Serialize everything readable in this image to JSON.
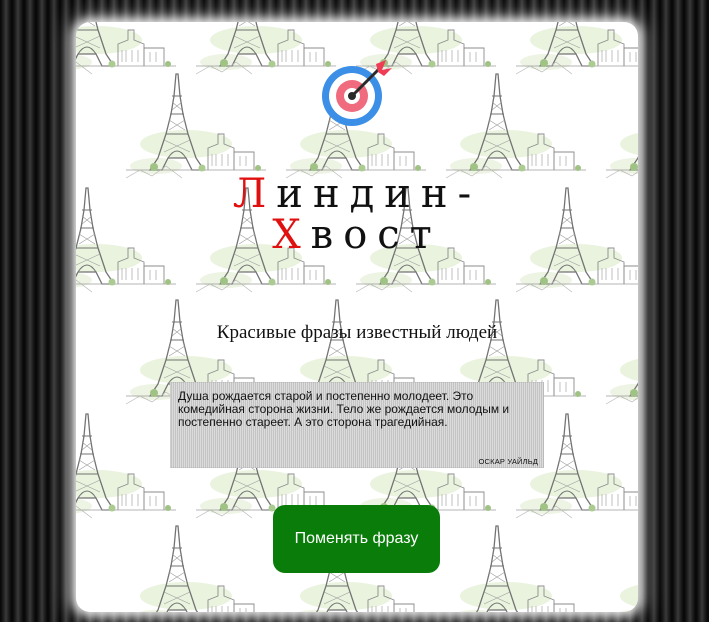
{
  "header": {
    "logo_icon": "target-dart-icon",
    "title_line1_first": "Л",
    "title_line1_rest": "индин-",
    "title_line2_first": "Х",
    "title_line2_rest": "вост",
    "title_accent_color": "#e01010"
  },
  "subtitle": "Красивые фразы известный людей",
  "quote": {
    "text": "Душа рождается старой и постепенно молодеет. Это комедийная сторона жизни. Тело же рождается молодым и постепенно стареет. А это сторона трагедийная.",
    "author": "ОСКАР УАЙЛЬД"
  },
  "actions": {
    "change_phrase_label": "Поменять фразу",
    "button_color": "#0a7c0a"
  },
  "background": {
    "pattern": "eiffel-tower-city-sketch-pattern"
  }
}
